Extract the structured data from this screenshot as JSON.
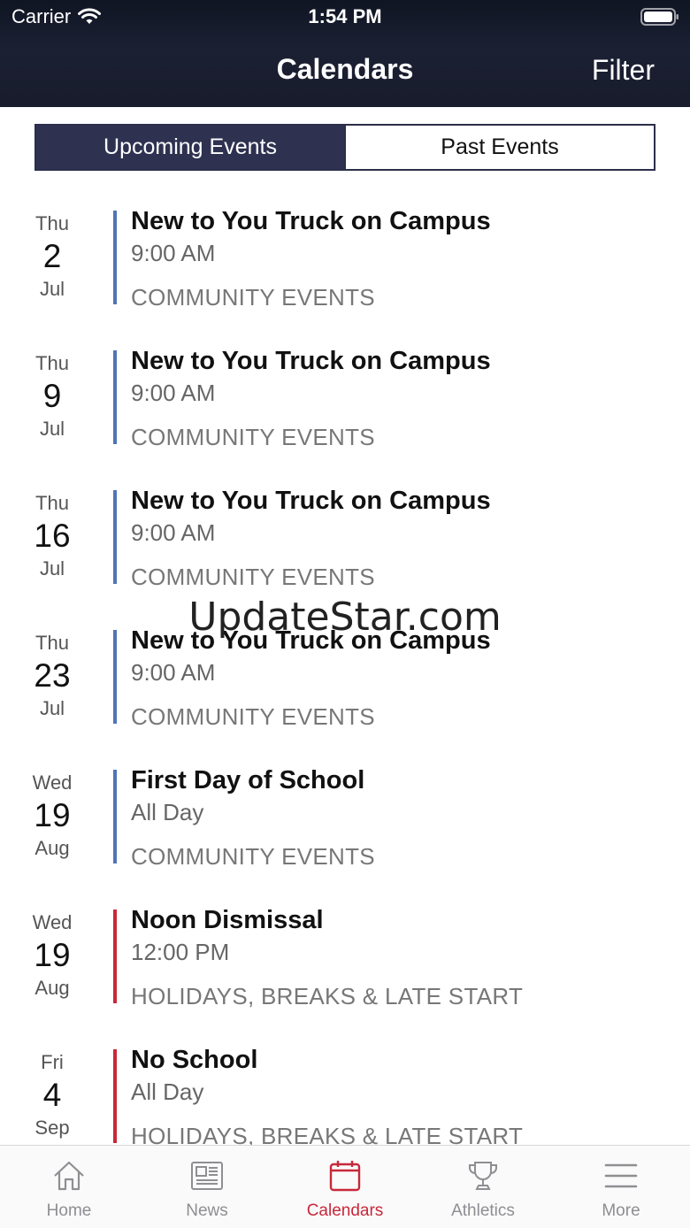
{
  "status": {
    "carrier": "Carrier",
    "time": "1:54 PM"
  },
  "nav": {
    "title": "Calendars",
    "filter": "Filter"
  },
  "segments": {
    "upcoming": "Upcoming Events",
    "past": "Past Events"
  },
  "events": [
    {
      "dow": "Thu",
      "day": "2",
      "month": "Jul",
      "title": "New to You Truck on Campus",
      "time": "9:00 AM",
      "category": "COMMUNITY EVENTS",
      "color": "#4f74b8"
    },
    {
      "dow": "Thu",
      "day": "9",
      "month": "Jul",
      "title": "New to You Truck on Campus",
      "time": "9:00 AM",
      "category": "COMMUNITY EVENTS",
      "color": "#4f74b8"
    },
    {
      "dow": "Thu",
      "day": "16",
      "month": "Jul",
      "title": "New to You Truck on Campus",
      "time": "9:00 AM",
      "category": "COMMUNITY EVENTS",
      "color": "#4f74b8"
    },
    {
      "dow": "Thu",
      "day": "23",
      "month": "Jul",
      "title": "New to You Truck on Campus",
      "time": "9:00 AM",
      "category": "COMMUNITY EVENTS",
      "color": "#4f74b8"
    },
    {
      "dow": "Wed",
      "day": "19",
      "month": "Aug",
      "title": "First Day of School",
      "time": "All Day",
      "category": "COMMUNITY EVENTS",
      "color": "#4f74b8"
    },
    {
      "dow": "Wed",
      "day": "19",
      "month": "Aug",
      "title": "Noon Dismissal",
      "time": "12:00 PM",
      "category": "HOLIDAYS, BREAKS & LATE START",
      "color": "#c8283a"
    },
    {
      "dow": "Fri",
      "day": "4",
      "month": "Sep",
      "title": "No School",
      "time": "All Day",
      "category": "HOLIDAYS, BREAKS & LATE START",
      "color": "#c8283a"
    }
  ],
  "watermark": "UpdateStar.com",
  "tabs": [
    {
      "label": "Home",
      "icon": "home-icon"
    },
    {
      "label": "News",
      "icon": "news-icon"
    },
    {
      "label": "Calendars",
      "icon": "calendar-icon",
      "active": true
    },
    {
      "label": "Athletics",
      "icon": "trophy-icon"
    },
    {
      "label": "More",
      "icon": "menu-icon"
    }
  ],
  "colors": {
    "active_tab": "#c8283a",
    "inactive_tab": "#8e8e93",
    "segment_active": "#2e3250"
  }
}
